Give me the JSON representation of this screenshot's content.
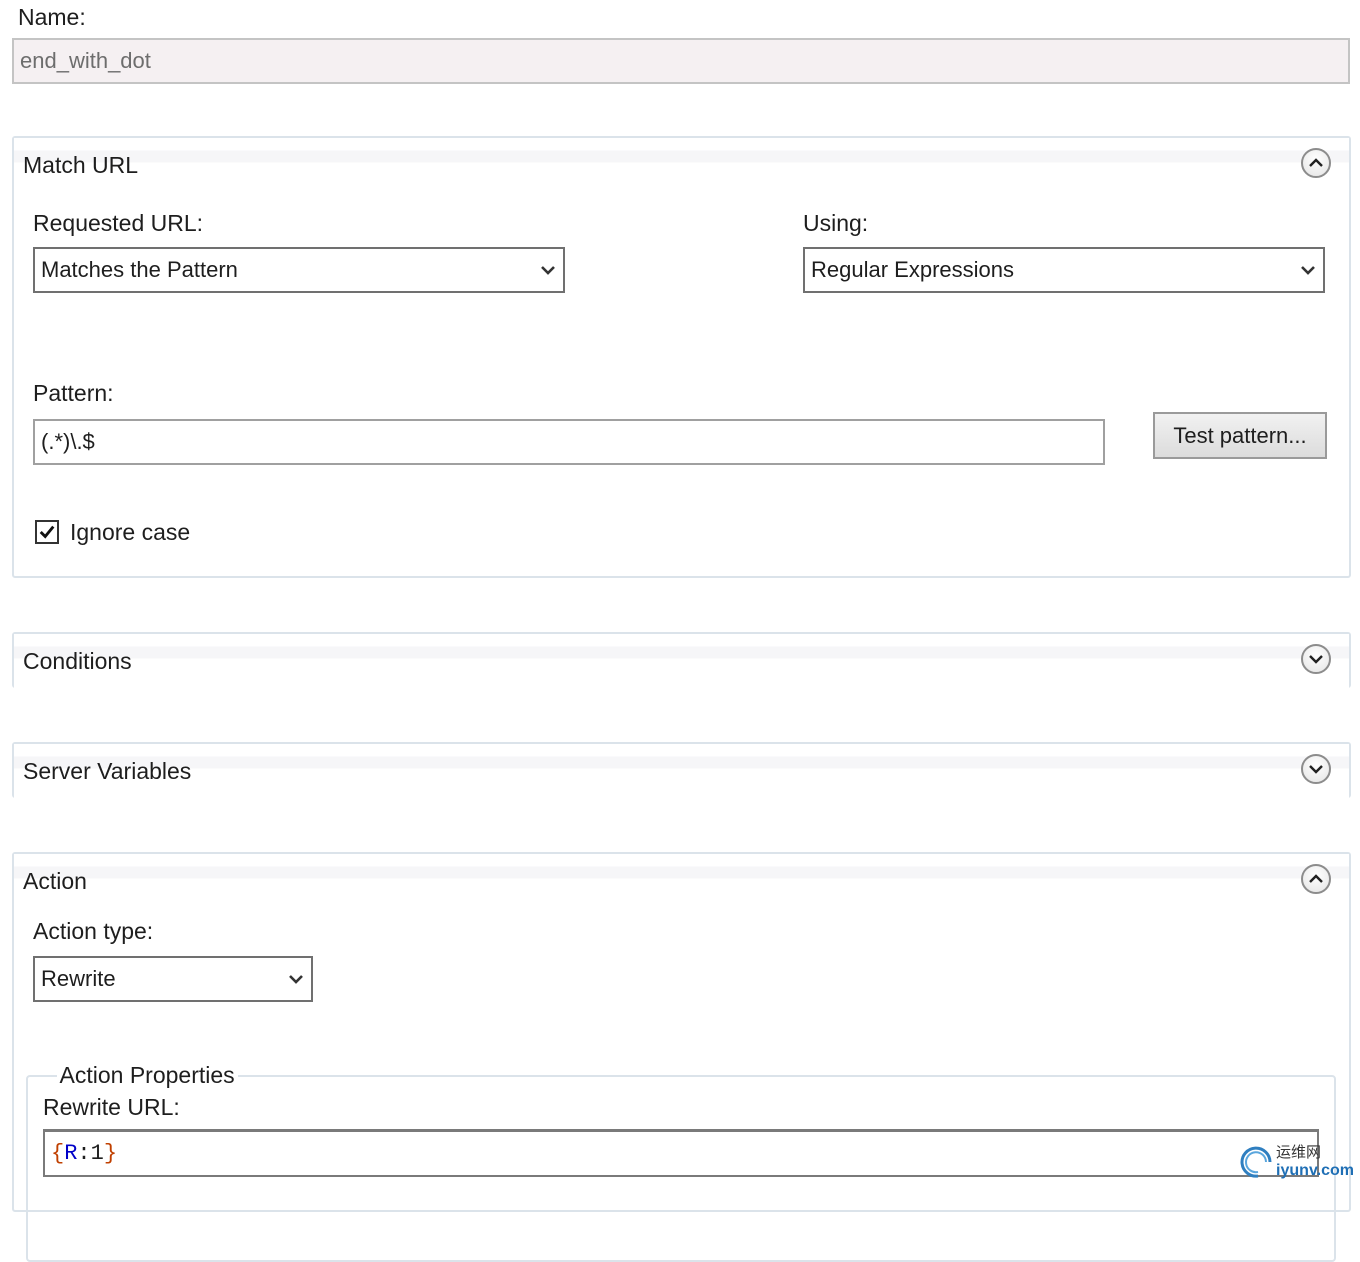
{
  "name": {
    "label": "Name:",
    "value": "end_with_dot"
  },
  "match_url": {
    "title": "Match URL",
    "requested_url_label": "Requested URL:",
    "requested_url_value": "Matches the Pattern",
    "using_label": "Using:",
    "using_value": "Regular Expressions",
    "pattern_label": "Pattern:",
    "pattern_value": "(.*)\\.$",
    "test_button": "Test pattern...",
    "ignore_case_label": "Ignore case",
    "ignore_case_checked": true,
    "expanded": true
  },
  "conditions": {
    "title": "Conditions",
    "expanded": false
  },
  "server_variables": {
    "title": "Server Variables",
    "expanded": false
  },
  "action": {
    "title": "Action",
    "action_type_label": "Action type:",
    "action_type_value": "Rewrite",
    "properties_title": "Action Properties",
    "rewrite_url_label": "Rewrite URL:",
    "rewrite_url": {
      "open": "{",
      "var": "R",
      "sep": ":",
      "num": "1",
      "close": "}"
    },
    "expanded": true
  },
  "watermark": {
    "line1": "运维网",
    "line2": "iyunv.com"
  },
  "colors": {
    "border": "#dbe3ea",
    "disabled_bg": "#f5f0f2",
    "brace": "#c04000",
    "variable": "#0000c8"
  },
  "icons": {
    "collapse": "chevron-up-icon",
    "expand": "chevron-down-icon",
    "dropdown": "chevron-down-icon",
    "check": "check-icon"
  }
}
